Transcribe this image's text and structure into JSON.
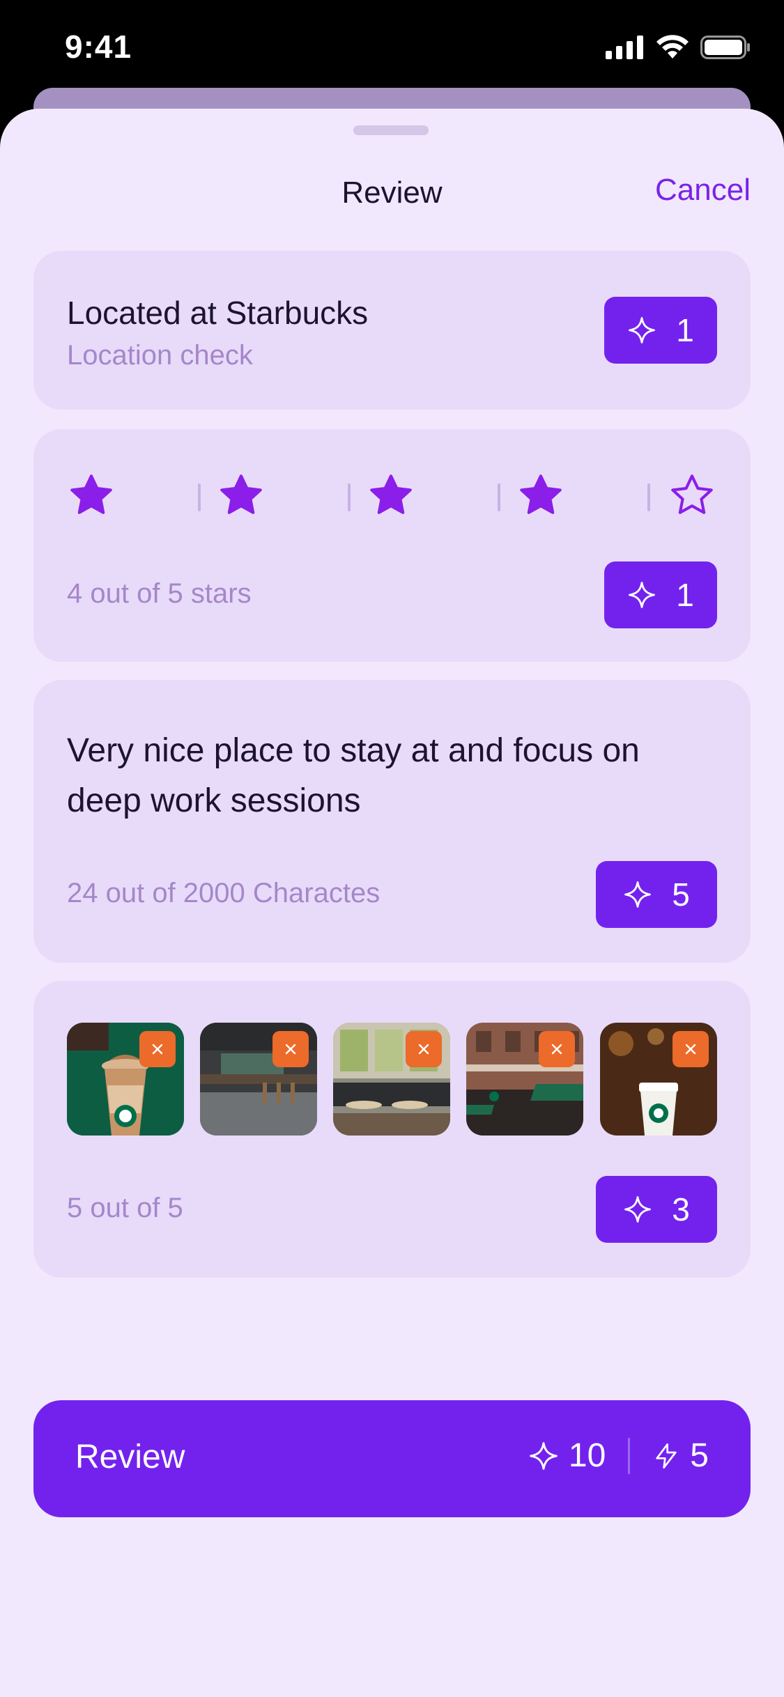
{
  "status_bar": {
    "time": "9:41"
  },
  "header": {
    "title": "Review",
    "cancel_label": "Cancel"
  },
  "location_card": {
    "title": "Located at Starbucks",
    "subtitle": "Location check",
    "points": "1"
  },
  "rating_card": {
    "rating": 4,
    "max_rating": 5,
    "label": "4 out of 5 stars",
    "points": "1"
  },
  "text_card": {
    "text": "Very nice place to stay at and focus on deep work sessions",
    "counter": "24 out of 2000 Charactes",
    "points": "5"
  },
  "photos_card": {
    "photos": [
      {
        "name": "photo-frappuccino"
      },
      {
        "name": "photo-cafe-interior"
      },
      {
        "name": "photo-cafe-seating"
      },
      {
        "name": "photo-storefront"
      },
      {
        "name": "photo-cup"
      }
    ],
    "counter": "5 out of 5",
    "points": "3"
  },
  "submit": {
    "label": "Review",
    "sparkle_points": "10",
    "bolt_points": "5"
  },
  "colors": {
    "accent": "#7322EE",
    "sheet_bg": "#F1E8FD",
    "card_bg": "#E8DBFA",
    "remove": "#EC6A2A",
    "muted_text": "#A587C9"
  }
}
